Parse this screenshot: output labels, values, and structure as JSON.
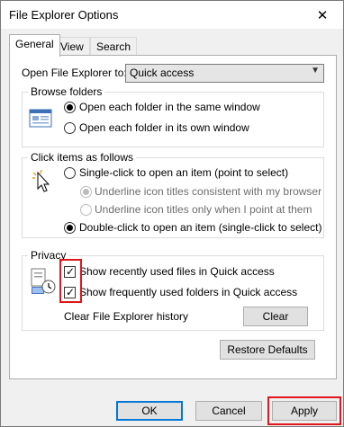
{
  "window": {
    "title": "File Explorer Options",
    "close_glyph": "✕"
  },
  "tabs": [
    {
      "label": "General",
      "active": true
    },
    {
      "label": "View",
      "active": false
    },
    {
      "label": "Search",
      "active": false
    }
  ],
  "general": {
    "open_to_label": "Open File Explorer to:",
    "open_to_value": "Quick access",
    "browse_folders": {
      "title": "Browse folders",
      "options": [
        {
          "label": "Open each folder in the same window",
          "checked": true
        },
        {
          "label": "Open each folder in its own window",
          "checked": false
        }
      ],
      "icon": "folder-window-icon"
    },
    "click_items": {
      "title": "Click items as follows",
      "options": [
        {
          "label": "Single-click to open an item (point to select)",
          "checked": false
        },
        {
          "label": "Underline icon titles consistent with my browser",
          "checked": true,
          "disabled": true
        },
        {
          "label": "Underline icon titles only when I point at them",
          "checked": false,
          "disabled": true
        },
        {
          "label": "Double-click to open an item (single-click to select)",
          "checked": true
        }
      ],
      "icon": "cursor-click-icon"
    },
    "privacy": {
      "title": "Privacy",
      "options": [
        {
          "label": "Show recently used files in Quick access",
          "checked": true
        },
        {
          "label": "Show frequently used folders in Quick access",
          "checked": true
        }
      ],
      "clear_history_label": "Clear File Explorer history",
      "clear_button": "Clear",
      "icon": "recent-files-icon"
    },
    "restore_defaults": "Restore Defaults"
  },
  "footer": {
    "ok": "OK",
    "cancel": "Cancel",
    "apply": "Apply"
  },
  "colors": {
    "highlight": "#e0161d",
    "accent": "#0078d7"
  }
}
